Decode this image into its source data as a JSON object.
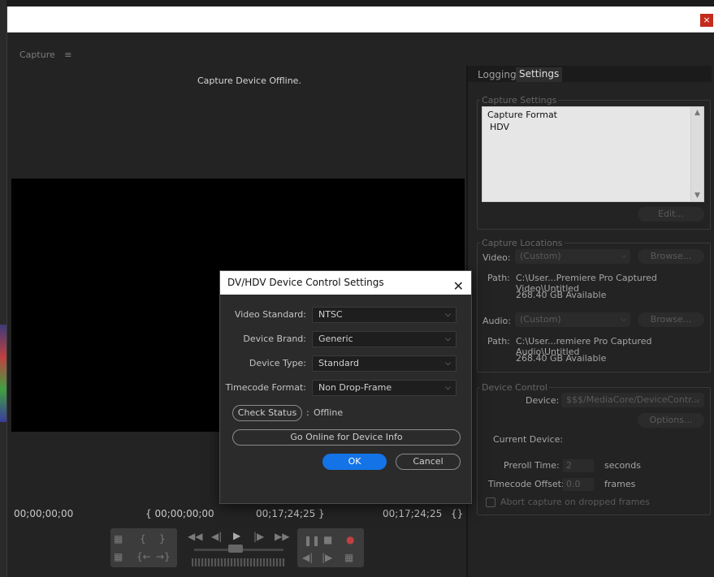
{
  "window": {
    "close_glyph": "×"
  },
  "panel": {
    "title": "Capture",
    "menu_icon": "≡",
    "offline_message": "Capture Device Offline."
  },
  "timecodes": {
    "current": "00;00;00;00",
    "in": "{ 00;00;00;00",
    "out": "00;17;24;25 }",
    "duration": "00;17;24;25",
    "duration_icon": "{}"
  },
  "tabs": [
    {
      "label": "Logging"
    },
    {
      "label": "Settings"
    }
  ],
  "capture_settings": {
    "group_label": "Capture Settings",
    "format_label": "Capture Format",
    "format_value": "HDV",
    "edit_button": "Edit..."
  },
  "capture_locations": {
    "group_label": "Capture Locations",
    "video_label": "Video:",
    "video_select": "(Custom)",
    "video_browse": "Browse...",
    "video_path_label": "Path:",
    "video_path": "C:\\User...Premiere Pro Captured Video\\Untitled",
    "video_available": "268.40 GB Available",
    "audio_label": "Audio:",
    "audio_select": "(Custom)",
    "audio_browse": "Browse...",
    "audio_path_label": "Path:",
    "audio_path": "C:\\User...remiere Pro Captured Audio\\Untitled",
    "audio_available": "268.40 GB Available"
  },
  "device_control": {
    "group_label": "Device Control",
    "device_label": "Device:",
    "device_select": "$$$/MediaCore/DeviceContr...",
    "options_button": "Options...",
    "current_device_label": "Current Device:",
    "preroll_label": "Preroll Time:",
    "preroll_value": "2",
    "preroll_unit": "seconds",
    "tc_offset_label": "Timecode Offset:",
    "tc_offset_value": "0.0",
    "tc_offset_unit": "frames",
    "abort_label": "Abort capture on dropped frames"
  },
  "dialog": {
    "title": "DV/HDV Device Control Settings",
    "close_glyph": "✕",
    "video_standard_label": "Video Standard:",
    "video_standard_value": "NTSC",
    "device_brand_label": "Device Brand:",
    "device_brand_value": "Generic",
    "device_type_label": "Device Type:",
    "device_type_value": "Standard",
    "timecode_format_label": "Timecode Format:",
    "timecode_format_value": "Non Drop-Frame",
    "check_status_button": "Check Status",
    "status_separator": ":",
    "status_value": "Offline",
    "online_info_button": "Go Online for Device Info",
    "ok_button": "OK",
    "cancel_button": "Cancel"
  },
  "colors": {
    "accent": "#1473e6",
    "close": "#c42b1c",
    "panel_bg": "#232323"
  }
}
